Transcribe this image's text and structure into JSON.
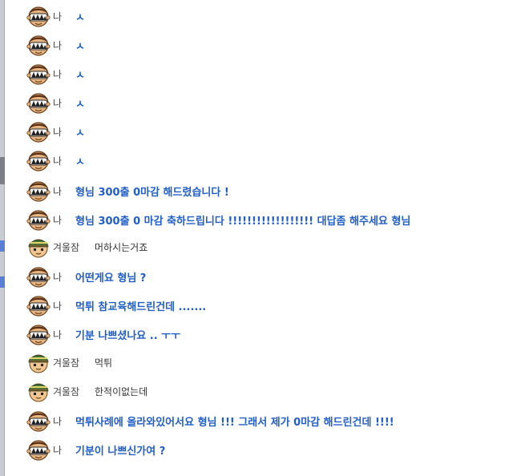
{
  "chat": {
    "messages": [
      {
        "sender": "나",
        "text": "ㅅ",
        "self": true
      },
      {
        "sender": "나",
        "text": "ㅅ",
        "self": true
      },
      {
        "sender": "나",
        "text": "ㅅ",
        "self": true
      },
      {
        "sender": "나",
        "text": "ㅅ",
        "self": true
      },
      {
        "sender": "나",
        "text": "ㅅ",
        "self": true
      },
      {
        "sender": "나",
        "text": "ㅅ",
        "self": true
      },
      {
        "sender": "나",
        "text": "형님 300출 0마감 해드렸습니다 !",
        "self": true
      },
      {
        "sender": "나",
        "text": "형님 300출 0 마감 축하드립니다 !!!!!!!!!!!!!!!!!! 대답좀 해주세요 형님",
        "self": true
      },
      {
        "sender": "겨울잠",
        "text": "머하시는거죠",
        "self": false
      },
      {
        "sender": "나",
        "text": "어떤게요 형님 ?",
        "self": true
      },
      {
        "sender": "나",
        "text": "먹튀 참교육해드린건데 .......",
        "self": true
      },
      {
        "sender": "나",
        "text": "기분 나쁘셨나요 .. ㅜㅜ",
        "self": true
      },
      {
        "sender": "겨울잠",
        "text": "먹튀",
        "self": false
      },
      {
        "sender": "겨울잠",
        "text": "한적이없는데",
        "self": false
      },
      {
        "sender": "나",
        "text": "먹튀사례에 올라와있어서요 형님 !!! 그래서 제가 0마감 해드린건데 !!!!",
        "self": true
      },
      {
        "sender": "나",
        "text": "기분이 나쁘신가여 ?",
        "self": true
      }
    ]
  },
  "colors": {
    "self_text": "#1f5ec9",
    "other_text": "#333333",
    "name_text": "#444444"
  },
  "icons": {
    "self_avatar": "avatar-sunglasses-icon",
    "other_avatar": "avatar-beanie-icon"
  }
}
